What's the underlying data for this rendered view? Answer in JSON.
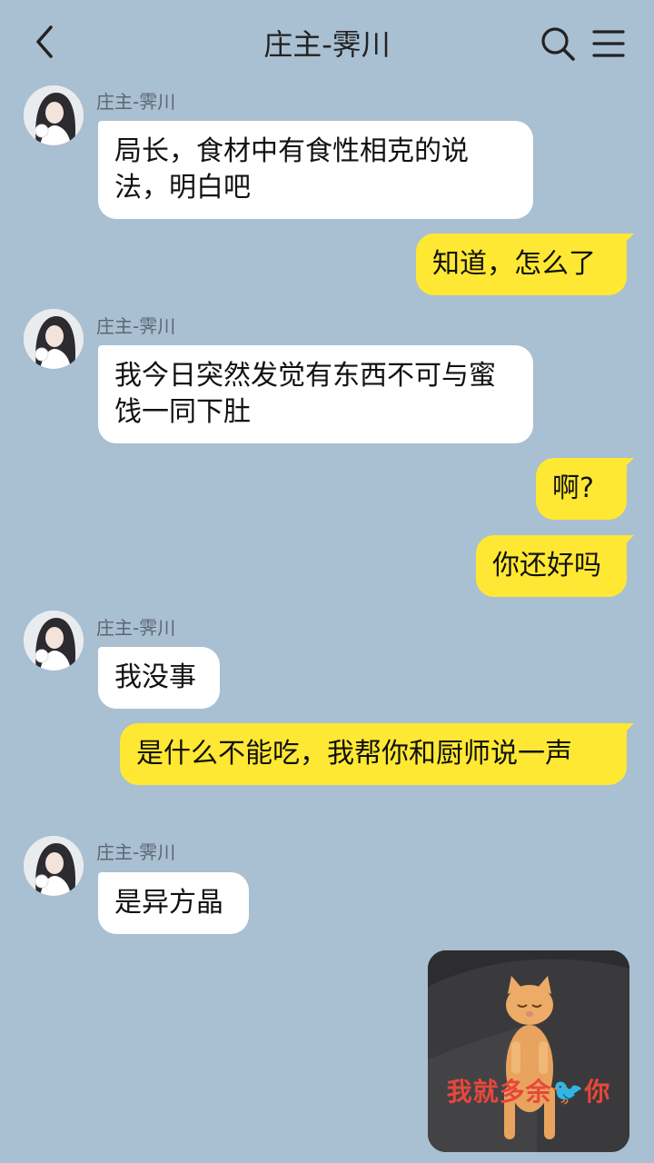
{
  "header": {
    "title": "庄主-霁川",
    "back_icon": "chevron-left-icon",
    "search_icon": "search-icon",
    "menu_icon": "menu-icon"
  },
  "contact_name": "庄主-霁川",
  "messages": [
    {
      "from": "them",
      "text": "局长，食材中有食性相克的说法，明白吧"
    },
    {
      "from": "me",
      "text": "知道，怎么了"
    },
    {
      "from": "them",
      "text": "我今日突然发觉有东西不可与蜜饯一同下肚"
    },
    {
      "from": "me",
      "text": "啊?"
    },
    {
      "from": "me",
      "text": "你还好吗"
    },
    {
      "from": "them",
      "text": "我没事"
    },
    {
      "from": "me",
      "text": "是什么不能吃，我帮你和厨师说一声"
    },
    {
      "from": "them",
      "text": "是异方晶"
    }
  ],
  "sticker": {
    "caption": "我就多余🐦你",
    "description_icon": "sleeping-kitten-sticker"
  },
  "colors": {
    "background": "#a9bfd2",
    "incoming_bubble": "#ffffff",
    "outgoing_bubble": "#ffe833",
    "sticker_text": "#e8473b"
  }
}
